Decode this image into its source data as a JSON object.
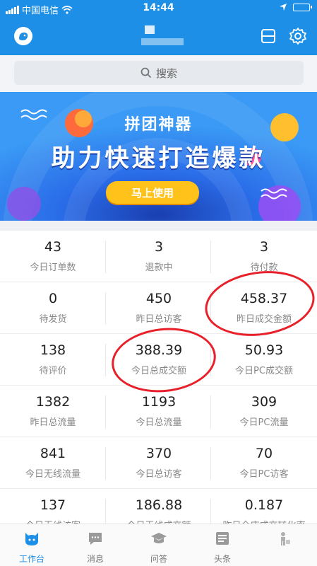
{
  "status_bar": {
    "carrier": "中国电信",
    "time": "14:44"
  },
  "search": {
    "placeholder": "搜索"
  },
  "banner": {
    "title": "拼团神器",
    "subtitle": "助力快速打造爆款",
    "button": "马上使用"
  },
  "metrics": [
    {
      "value": "43",
      "label": "今日订单数"
    },
    {
      "value": "3",
      "label": "退款中"
    },
    {
      "value": "3",
      "label": "待付款"
    },
    {
      "value": "0",
      "label": "待发货"
    },
    {
      "value": "450",
      "label": "昨日总访客"
    },
    {
      "value": "458.37",
      "label": "昨日成交金额"
    },
    {
      "value": "138",
      "label": "待评价"
    },
    {
      "value": "388.39",
      "label": "今日总成交额"
    },
    {
      "value": "50.93",
      "label": "今日PC成交额"
    },
    {
      "value": "1382",
      "label": "昨日总流量"
    },
    {
      "value": "1193",
      "label": "今日总流量"
    },
    {
      "value": "309",
      "label": "今日PC流量"
    },
    {
      "value": "841",
      "label": "今日无线流量"
    },
    {
      "value": "370",
      "label": "今日总访客"
    },
    {
      "value": "70",
      "label": "今日PC访客"
    },
    {
      "value": "137",
      "label": "今日无线访客"
    },
    {
      "value": "186.88",
      "label": "今日无线成交额"
    },
    {
      "value": "0.187",
      "label": "昨日全店成交转化率"
    }
  ],
  "tabs": [
    {
      "label": "工作台",
      "icon": "workbench-icon",
      "active": true
    },
    {
      "label": "消息",
      "icon": "message-icon",
      "active": false
    },
    {
      "label": "问答",
      "icon": "qa-icon",
      "active": false
    },
    {
      "label": "头条",
      "icon": "headlines-icon",
      "active": false
    },
    {
      "label": "",
      "icon": "profile-icon",
      "active": false
    }
  ],
  "colors": {
    "brand": "#1e8fe6",
    "banner_bg": "#2b7ef0",
    "button": "#ffc21a",
    "annotation": "#e8202a"
  }
}
